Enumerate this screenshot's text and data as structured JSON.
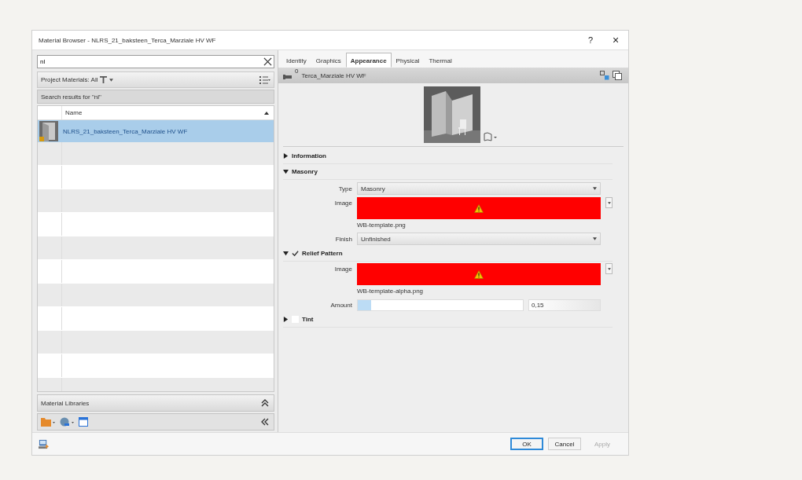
{
  "window": {
    "title": "Material Browser - NLRS_21_baksteen_Terca_Marziale HV WF",
    "help": "?",
    "close": "×"
  },
  "search": {
    "value": "nl"
  },
  "filter": {
    "label": "Project Materials: All"
  },
  "results_label": "Search results for \"nl\"",
  "table": {
    "columns": [
      "Name"
    ],
    "rows": [
      {
        "name": "NLRS_21_baksteen_Terca_Marziale HV WF",
        "selected": true
      }
    ]
  },
  "libraries": {
    "title": "Material Libraries"
  },
  "tabs": [
    {
      "label": "Identity",
      "selected": false
    },
    {
      "label": "Graphics",
      "selected": false
    },
    {
      "label": "Appearance",
      "selected": true
    },
    {
      "label": "Physical",
      "selected": false
    },
    {
      "label": "Thermal",
      "selected": false
    }
  ],
  "asset": {
    "name": "Terca_Marziale HV WF",
    "count": "0"
  },
  "sections": [
    {
      "title": "Information",
      "kind": "plain",
      "expanded": false
    },
    {
      "title": "Masonry",
      "kind": "plain",
      "expanded": true,
      "fields": [
        {
          "kind": "dropdown",
          "label": "Type",
          "value": "Masonry"
        },
        {
          "label": "Image",
          "file": "WB-template.png",
          "missing": true
        },
        {
          "kind": "dropdown",
          "label": "Finish",
          "value": "Unfinished"
        }
      ]
    },
    {
      "title": "Relief Pattern",
      "kind": "toggle",
      "checked": true,
      "expanded": true,
      "fields": [
        {
          "label": "Image",
          "file": "WB-template-alpha.png",
          "missing": true
        },
        {
          "kind": "slider",
          "label": "Amount",
          "level": 0.08,
          "value": "0,15"
        }
      ]
    },
    {
      "title": "Tint",
      "kind": "toggle",
      "checked": false,
      "expanded": false
    }
  ],
  "buttons": [
    {
      "label": "OK",
      "default": true,
      "disabled": false
    },
    {
      "label": "Cancel",
      "default": false,
      "disabled": false
    },
    {
      "label": "Apply",
      "default": false,
      "disabled": true
    }
  ]
}
